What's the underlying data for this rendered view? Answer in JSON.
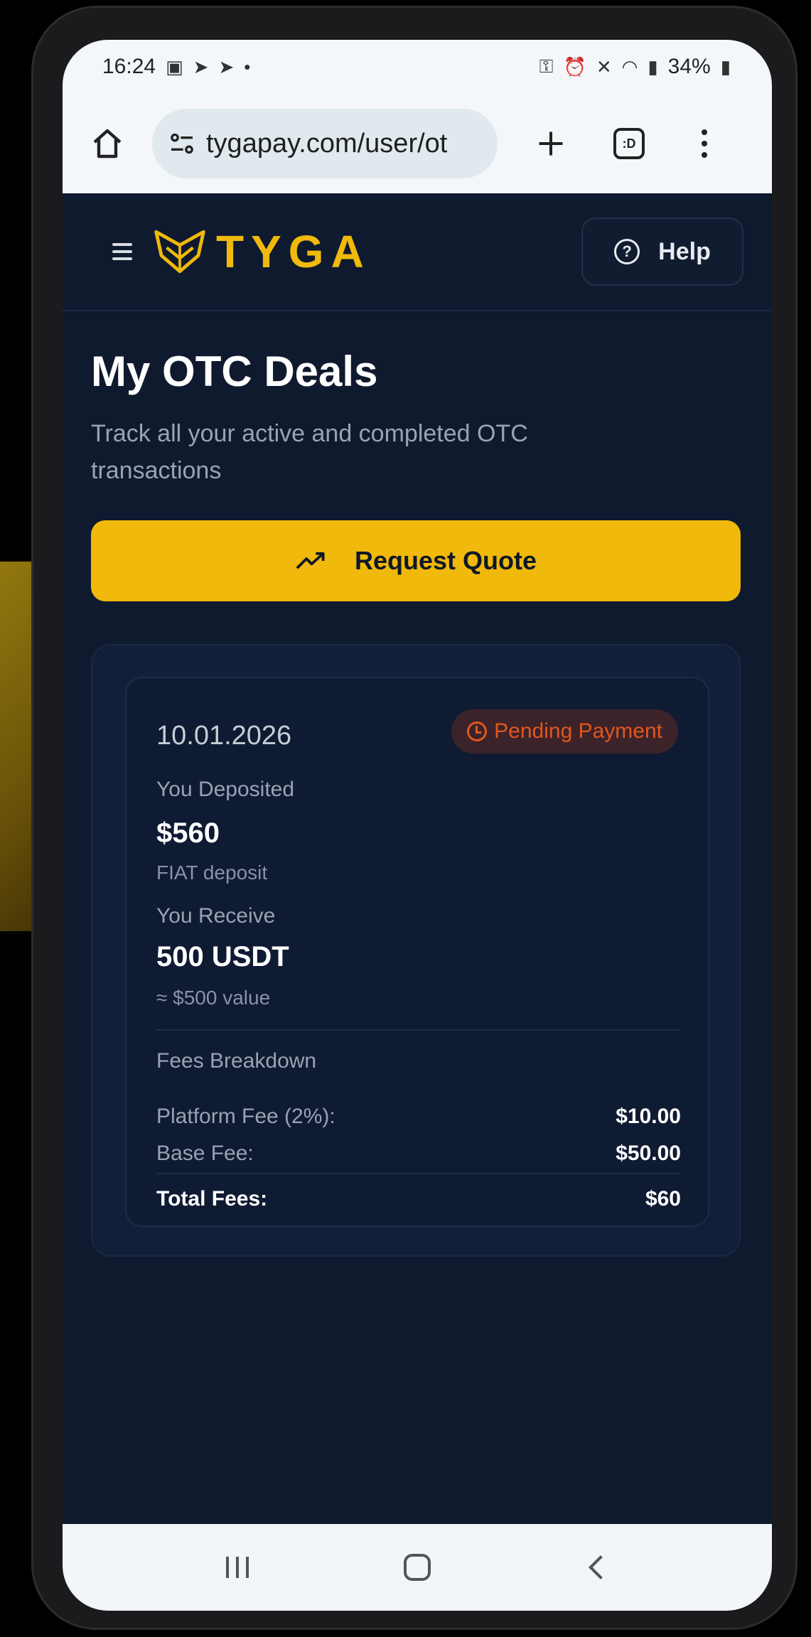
{
  "status_bar": {
    "time": "16:24",
    "battery": "34%"
  },
  "browser": {
    "url": "tygapay.com/user/ot",
    "tabs_label": ":D"
  },
  "header": {
    "brand": "TYGA",
    "help_label": "Help",
    "help_icon_glyph": "?"
  },
  "page": {
    "title": "My OTC Deals",
    "subtitle": "Track all your active and completed OTC transactions",
    "request_button": "Request Quote",
    "request_icon_glyph": "↗"
  },
  "deal": {
    "date": "10.01.2026",
    "status": "Pending Payment",
    "deposited_label": "You Deposited",
    "deposited_amount": "$560",
    "deposit_type": "FIAT deposit",
    "receive_label": "You Receive",
    "receive_amount": "500 USDT",
    "receive_value": "≈ $500 value",
    "fees_title": "Fees Breakdown",
    "fees": [
      {
        "label": "Platform Fee (2%):",
        "value": "$10.00"
      },
      {
        "label": "Base Fee:",
        "value": "$50.00"
      }
    ],
    "total_label": "Total Fees:",
    "total_value": "$60"
  },
  "colors": {
    "accent": "#f0b90b",
    "background": "#0f1a2f",
    "pending": "#e3561d"
  },
  "icons": [
    "home-icon",
    "site-settings-icon",
    "plus-icon",
    "tabs-icon",
    "more-icon",
    "hamburger-icon",
    "help-icon",
    "trending-up-icon",
    "clock-icon",
    "recents-icon",
    "home-nav-icon",
    "back-icon"
  ]
}
